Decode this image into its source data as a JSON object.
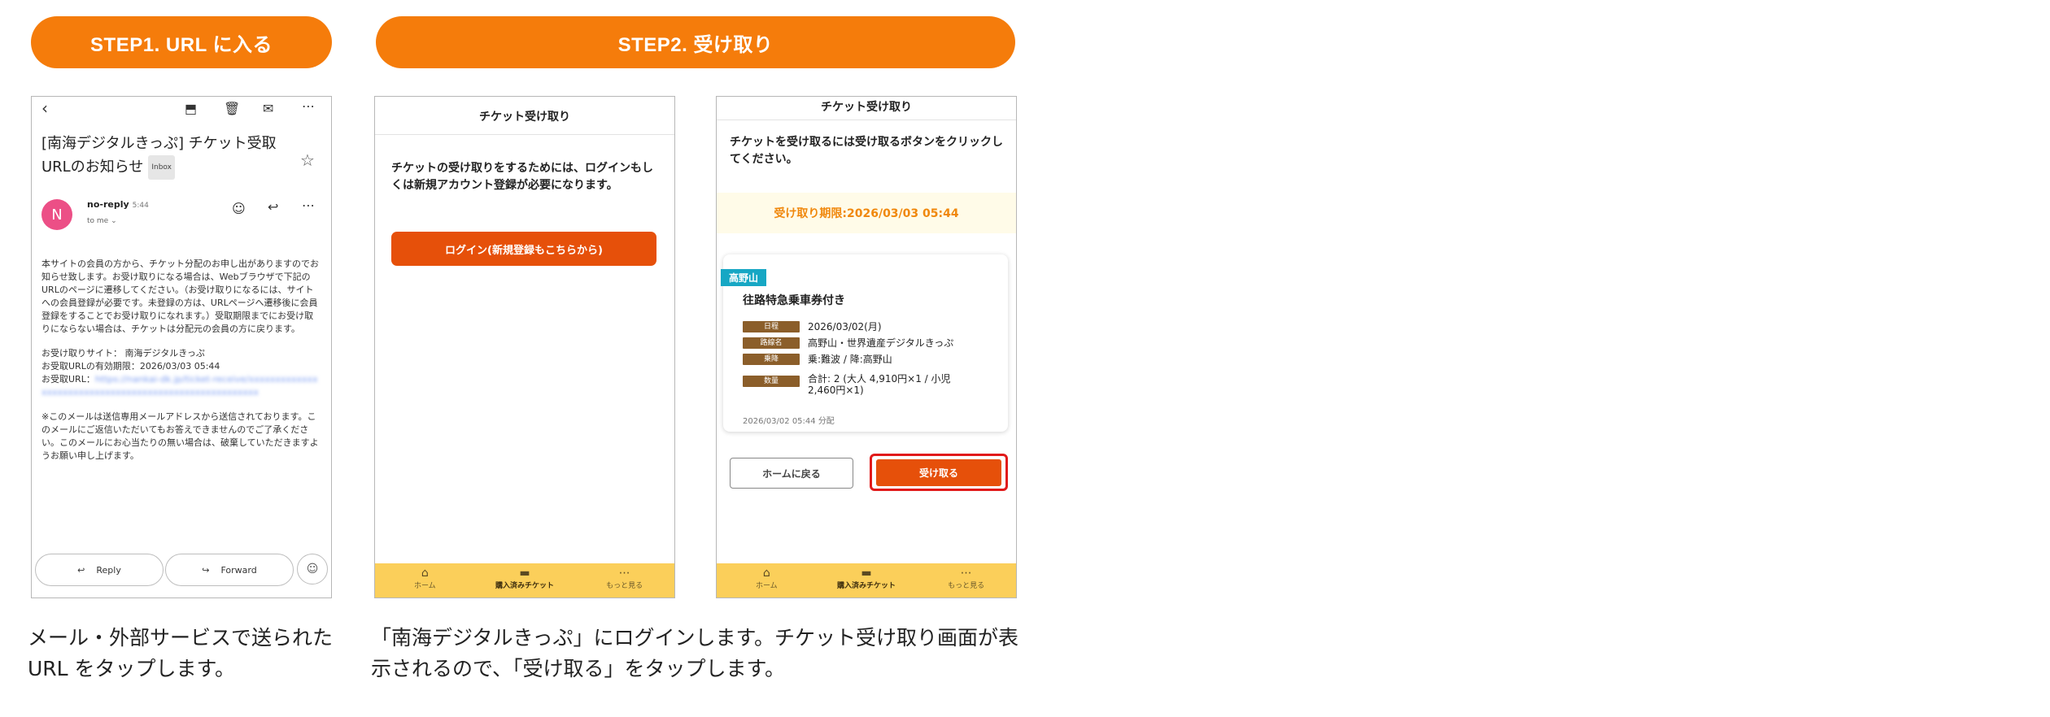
{
  "steps": {
    "step1_label": "STEP1. URL に入る",
    "step2_label": "STEP2. 受け取り"
  },
  "mail": {
    "subject": "[南海デジタルきっぷ] チケット受取URLのお知らせ",
    "inbox_tag": "Inbox",
    "avatar_letter": "N",
    "sender": "no-reply",
    "time": "5:44",
    "to": "to me",
    "body_p1": "本サイトの会員の方から、チケット分配のお申し出がありますのでお知らせ致します。お受け取りになる場合は、Webブラウザで下記のURLのページに遷移してください。（お受け取りになるには、サイトへの会員登録が必要です。未登録の方は、URLページへ遷移後に会員登録をすることでお受け取りになれます。）受取期限までにお受け取りにならない場合は、チケットは分配元の会員の方に戻ります。",
    "site_line": "お受け取りサイト： 南海デジタルきっぷ",
    "expiry_line": "お受取URLの有効期限：2026/03/03 05:44",
    "url_label": "お受取URL：",
    "url_blurred": "https://nankai-dk.jp/ticket-receive/xxxxxxxxxxxxxxxxxxxxxxxxxxxxxxxxxxxxxxxxxxxxxxxxxxxxxx",
    "footer_p": "※このメールは送信専用メールアドレスから送信されております。このメールにご返信いただいてもお答えできませんのでご了承ください。このメールにお心当たりの無い場合は、破棄していただきますようお願い申し上げます。",
    "reply_label": "Reply",
    "forward_label": "Forward"
  },
  "login_screen": {
    "title": "チケット受け取り",
    "message": "チケットの受け取りをするためには、ログインもしくは新規アカウント登録が必要になります。",
    "login_button": "ログイン(新規登録もこちらから)"
  },
  "receive_screen": {
    "title": "チケット受け取り",
    "message": "チケットを受け取るには受け取るボタンをクリックしてください。",
    "deadline": "受け取り期限:2026/03/03 05:44",
    "destination_tag": "高野山",
    "ticket_name": "往路特急乗車券付き",
    "rows": [
      {
        "label": "日程",
        "value": "2026/03/02(月)"
      },
      {
        "label": "路線名",
        "value": "高野山・世界遺産デジタルきっぷ"
      },
      {
        "label": "乗降",
        "value": "乗:難波 / 降:高野山"
      },
      {
        "label": "数量",
        "value": "合計: 2 (大人 4,910円×1 / 小児 2,460円×1)"
      }
    ],
    "issued": "2026/03/02 05:44 分配",
    "home_button": "ホームに戻る",
    "receive_button": "受け取る"
  },
  "tabbar": {
    "home": "ホーム",
    "purchased": "購入済みチケット",
    "more": "もっと見る"
  },
  "captions": {
    "step1": "メール・外部サービスで送られた URL をタップします。",
    "step2": "「南海デジタルきっぷ」にログインします。チケット受け取り画面が表示されるので、「受け取る」をタップします。"
  },
  "colors": {
    "accent_orange": "#f57c0b",
    "button_orange": "#e6500a",
    "tabbar_yellow": "#fbcf5a",
    "tag_teal": "#17a7c4",
    "label_brown": "#8b5e2a",
    "highlight_red": "#e11a1a"
  }
}
